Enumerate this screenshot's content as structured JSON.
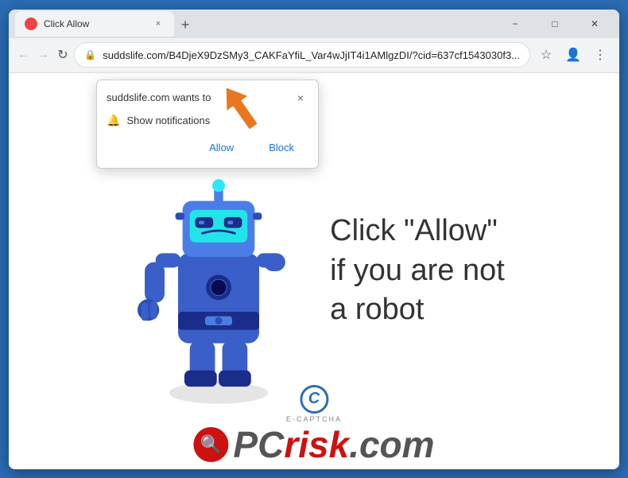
{
  "browser": {
    "title": "Click Allow",
    "url": "suddslife.com/B4DjeX9DzSMy3_CAKFaYfiL_Var4wJjIT4i1AMlgzDI/?cid=637cf1543030f3...",
    "tab_favicon_color": "#e44444"
  },
  "toolbar": {
    "back_label": "←",
    "forward_label": "→",
    "reload_label": "↻",
    "new_tab_label": "+"
  },
  "window_controls": {
    "minimize": "−",
    "maximize": "□",
    "close": "✕"
  },
  "permission_popup": {
    "title": "suddslife.com wants to",
    "close_label": "×",
    "notification_text": "Show notifications",
    "allow_label": "Allow",
    "block_label": "Block"
  },
  "page": {
    "main_text": "Click \"Allow\"\nif you are not\na robot",
    "captcha_letter": "C",
    "captcha_sub": "E-CAPTCHA",
    "pcrisk_text": "PCrisk.com"
  }
}
